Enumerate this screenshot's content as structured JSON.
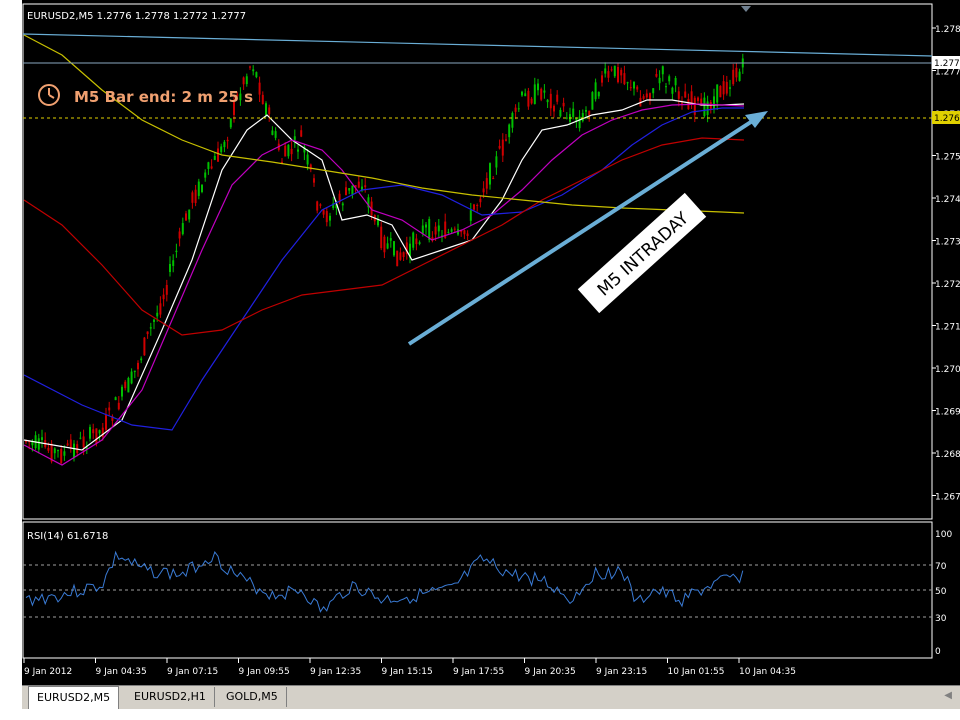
{
  "main_chart": {
    "symbol_info": "EURUSD2,M5  1.2776 1.2778 1.2772 1.2777",
    "bar_timer": "M5 Bar end: 2 m 25 s",
    "annotation": "M5 INTRADAY",
    "current_price_tag": "1.277",
    "dotted_level_tag": "1.276",
    "price_ticks": [
      "1.278",
      "1.277",
      "1.276",
      "1.275",
      "1.274",
      "1.273",
      "1.272",
      "1.271",
      "1.270",
      "1.269",
      "1.268",
      "1.267"
    ],
    "colors": {
      "bull_candle": "#00c000",
      "bear_candle": "#d00000",
      "ma_white": "#ffffff",
      "ma_magenta": "#c000c0",
      "ma_blue": "#2020e0",
      "ma_red": "#c00000",
      "ma_yellow": "#c8c000",
      "trendline": "#6aaed6",
      "dotted_level": "#e0d000",
      "timer_text": "#f0a070"
    }
  },
  "rsi_panel": {
    "label": "RSI(14) 61.6718",
    "ticks": [
      "100",
      "70",
      "50",
      "30",
      "0"
    ],
    "line_color": "#3a7bd5"
  },
  "time_axis": [
    "9 Jan 2012",
    "9 Jan 04:35",
    "9 Jan 07:15",
    "9 Jan 09:55",
    "9 Jan 12:35",
    "9 Jan 15:15",
    "9 Jan 17:55",
    "9 Jan 20:35",
    "9 Jan 23:15",
    "10 Jan 01:55",
    "10 Jan 04:35"
  ],
  "tabs": [
    {
      "label": "EURUSD2,M5",
      "active": true
    },
    {
      "label": "EURUSD2,H1",
      "active": false
    },
    {
      "label": "GOLD,M5",
      "active": false
    }
  ]
}
